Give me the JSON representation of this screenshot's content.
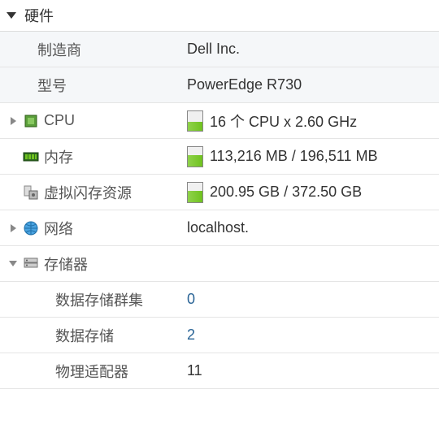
{
  "section": {
    "title": "硬件"
  },
  "rows": {
    "manufacturer": {
      "label": "制造商",
      "value": "Dell Inc."
    },
    "model": {
      "label": "型号",
      "value": "PowerEdge R730"
    },
    "cpu": {
      "label": "CPU",
      "value": "16 个 CPU x 2.60 GHz",
      "usage_pct": 45
    },
    "memory": {
      "label": "内存",
      "value": "113,216 MB / 196,511 MB",
      "usage_pct": 58
    },
    "vflash": {
      "label": "虚拟闪存资源",
      "value": "200.95 GB / 372.50 GB",
      "usage_pct": 55
    },
    "network": {
      "label": "网络",
      "value": "localhost."
    },
    "storage": {
      "label": "存储器"
    },
    "ds_cluster": {
      "label": "数据存储群集",
      "value": "0"
    },
    "datastore": {
      "label": "数据存储",
      "value": "2"
    },
    "phys_adapter": {
      "label": "物理适配器",
      "value": "11"
    }
  }
}
